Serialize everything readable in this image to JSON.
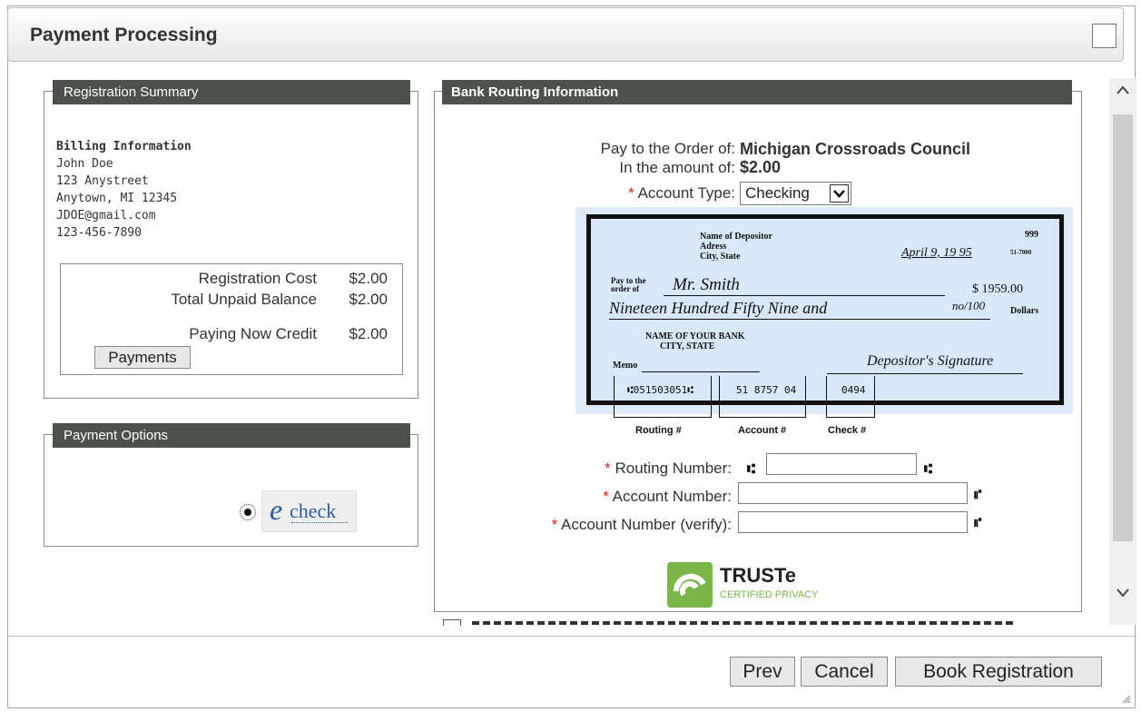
{
  "dialog": {
    "title": "Payment Processing"
  },
  "registration_summary": {
    "legend": "Registration Summary",
    "billing_heading": "Billing Information",
    "billing_lines": [
      "John Doe",
      "123 Anystreet",
      "Anytown, MI 12345",
      "JDOE@gmail.com",
      "123-456-7890"
    ],
    "rows": [
      {
        "label": "Registration Cost",
        "amount": "$2.00"
      },
      {
        "label": "Total Unpaid Balance",
        "amount": "$2.00"
      },
      {
        "label": "Paying Now Credit",
        "amount": "$2.00"
      }
    ],
    "payments_button": "Payments"
  },
  "payment_options": {
    "legend": "Payment Options",
    "echeck_label": "check",
    "echeck_prefix": "e",
    "selected": true
  },
  "bank_routing": {
    "legend": "Bank Routing Information",
    "pay_to_label": "Pay to the Order of:",
    "pay_to_value": "Michigan Crossroads Council",
    "amount_label": "In the amount of:",
    "amount_value": "$2.00",
    "account_type_label": "Account Type:",
    "account_type_value": "Checking",
    "routing_label": "Routing Number:",
    "account_label": "Account Number:",
    "account_verify_label": "Account Number (verify):",
    "required_mark": "*"
  },
  "check_sample": {
    "depositor": [
      "Name of Depositor",
      "Adress",
      "City, State"
    ],
    "number": "999",
    "fraction": "51-7000",
    "date": "April 9, 19 95",
    "pay_to_prefix": "Pay to the order of",
    "payee": "Mr. Smith",
    "amount": "$ 1959.00",
    "amount_words": "Nineteen Hundred Fifty Nine and",
    "cents": "no/100",
    "dollars": "Dollars",
    "bank": [
      "NAME OF YOUR BANK",
      "CITY, STATE"
    ],
    "memo": "Memo",
    "signature": "Depositor's Signature",
    "micr_routing": "⑆051503051⑆",
    "micr_account": "51 8757 04",
    "micr_check": "0494",
    "caption_routing": "Routing #",
    "caption_account": "Account #",
    "caption_check": "Check #"
  },
  "truste": {
    "name": "TRUSTe",
    "tagline": "CERTIFIED PRIVACY"
  },
  "footer": {
    "prev": "Prev",
    "cancel": "Cancel",
    "book": "Book Registration"
  },
  "colors": {
    "legend_bg": "#4b5249",
    "required": "#d22222",
    "truste_green": "#7ab648"
  }
}
